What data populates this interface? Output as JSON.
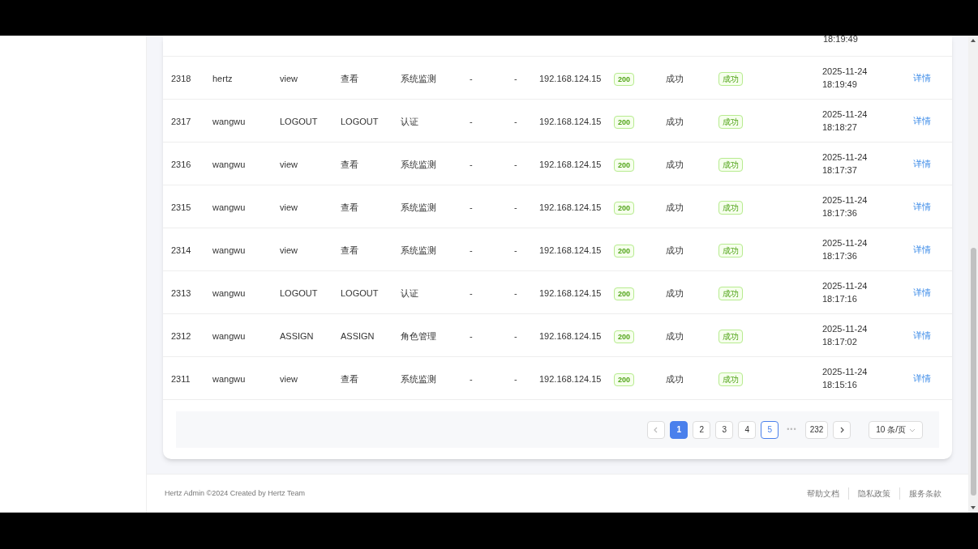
{
  "table": {
    "partial_row": {
      "time_line2": "18:19:49"
    },
    "rows": [
      {
        "id": "2318",
        "user": "hertz",
        "action": "view",
        "action_name": "查看",
        "module": "系统监测",
        "col_6": "-",
        "col_7": "-",
        "ip": "192.168.124.15",
        "code": "200",
        "result": "成功",
        "status": "成功",
        "date": "2025-11-24",
        "time": "18:19:49",
        "link": "详情"
      },
      {
        "id": "2317",
        "user": "wangwu",
        "action": "LOGOUT",
        "action_name": "LOGOUT",
        "module": "认证",
        "col_6": "-",
        "col_7": "-",
        "ip": "192.168.124.15",
        "code": "200",
        "result": "成功",
        "status": "成功",
        "date": "2025-11-24",
        "time": "18:18:27",
        "link": "详情"
      },
      {
        "id": "2316",
        "user": "wangwu",
        "action": "view",
        "action_name": "查看",
        "module": "系统监测",
        "col_6": "-",
        "col_7": "-",
        "ip": "192.168.124.15",
        "code": "200",
        "result": "成功",
        "status": "成功",
        "date": "2025-11-24",
        "time": "18:17:37",
        "link": "详情"
      },
      {
        "id": "2315",
        "user": "wangwu",
        "action": "view",
        "action_name": "查看",
        "module": "系统监测",
        "col_6": "-",
        "col_7": "-",
        "ip": "192.168.124.15",
        "code": "200",
        "result": "成功",
        "status": "成功",
        "date": "2025-11-24",
        "time": "18:17:36",
        "link": "详情"
      },
      {
        "id": "2314",
        "user": "wangwu",
        "action": "view",
        "action_name": "查看",
        "module": "系统监测",
        "col_6": "-",
        "col_7": "-",
        "ip": "192.168.124.15",
        "code": "200",
        "result": "成功",
        "status": "成功",
        "date": "2025-11-24",
        "time": "18:17:36",
        "link": "详情"
      },
      {
        "id": "2313",
        "user": "wangwu",
        "action": "LOGOUT",
        "action_name": "LOGOUT",
        "module": "认证",
        "col_6": "-",
        "col_7": "-",
        "ip": "192.168.124.15",
        "code": "200",
        "result": "成功",
        "status": "成功",
        "date": "2025-11-24",
        "time": "18:17:16",
        "link": "详情"
      },
      {
        "id": "2312",
        "user": "wangwu",
        "action": "ASSIGN",
        "action_name": "ASSIGN",
        "module": "角色管理",
        "col_6": "-",
        "col_7": "-",
        "ip": "192.168.124.15",
        "code": "200",
        "result": "成功",
        "status": "成功",
        "date": "2025-11-24",
        "time": "18:17:02",
        "link": "详情"
      },
      {
        "id": "2311",
        "user": "wangwu",
        "action": "view",
        "action_name": "查看",
        "module": "系统监测",
        "col_6": "-",
        "col_7": "-",
        "ip": "192.168.124.15",
        "code": "200",
        "result": "成功",
        "status": "成功",
        "date": "2025-11-24",
        "time": "18:15:16",
        "link": "详情"
      }
    ]
  },
  "pagination": {
    "pages": [
      {
        "label": "1",
        "selected": true,
        "hovered": false
      },
      {
        "label": "2",
        "selected": false,
        "hovered": false
      },
      {
        "label": "3",
        "selected": false,
        "hovered": false
      },
      {
        "label": "4",
        "selected": false,
        "hovered": false
      },
      {
        "label": "5",
        "selected": false,
        "hovered": true
      }
    ],
    "ellipsis": "•••",
    "last_page": "232",
    "page_size": "10 条/页"
  },
  "footer": {
    "copyright": "Hertz Admin ©2024 Created by Hertz Team",
    "links": [
      "帮助文档",
      "隐私政策",
      "服务条款"
    ]
  }
}
